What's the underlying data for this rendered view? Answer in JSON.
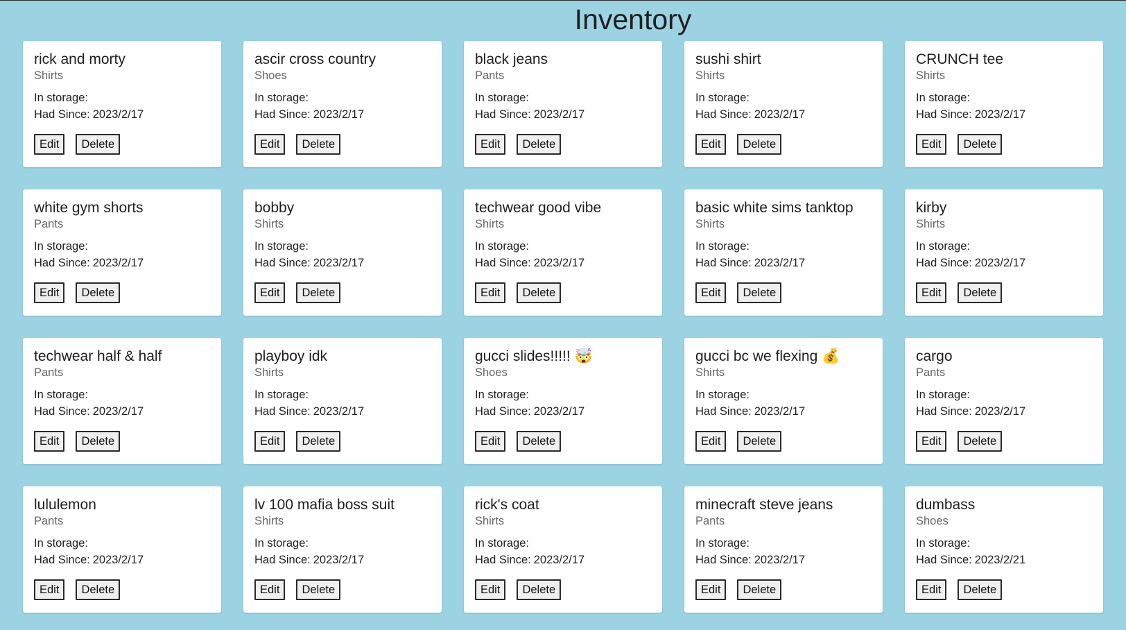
{
  "page": {
    "title": "Inventory"
  },
  "labels": {
    "storage_label": "In storage:",
    "since_label": "Had Since:",
    "edit_label": "Edit",
    "delete_label": "Delete"
  },
  "items": [
    {
      "name": "rick and morty",
      "category": "Shirts",
      "storage": "",
      "since": "2023/2/17"
    },
    {
      "name": "ascir cross country",
      "category": "Shoes",
      "storage": "",
      "since": "2023/2/17"
    },
    {
      "name": "black jeans",
      "category": "Pants",
      "storage": "",
      "since": "2023/2/17"
    },
    {
      "name": "sushi shirt",
      "category": "Shirts",
      "storage": "",
      "since": "2023/2/17"
    },
    {
      "name": "CRUNCH tee",
      "category": "Shirts",
      "storage": "",
      "since": "2023/2/17"
    },
    {
      "name": "white gym shorts",
      "category": "Pants",
      "storage": "",
      "since": "2023/2/17"
    },
    {
      "name": "bobby",
      "category": "Shirts",
      "storage": "",
      "since": "2023/2/17"
    },
    {
      "name": "techwear good vibe",
      "category": "Shirts",
      "storage": "",
      "since": "2023/2/17"
    },
    {
      "name": "basic white sims tanktop",
      "category": "Shirts",
      "storage": "",
      "since": "2023/2/17"
    },
    {
      "name": "kirby",
      "category": "Shirts",
      "storage": "",
      "since": "2023/2/17"
    },
    {
      "name": "techwear half & half",
      "category": "Pants",
      "storage": "",
      "since": "2023/2/17"
    },
    {
      "name": "playboy idk",
      "category": "Shirts",
      "storage": "",
      "since": "2023/2/17"
    },
    {
      "name": "gucci slides!!!!! 🤯",
      "category": "Shoes",
      "storage": "",
      "since": "2023/2/17"
    },
    {
      "name": "gucci bc we flexing 💰",
      "category": "Shirts",
      "storage": "",
      "since": "2023/2/17"
    },
    {
      "name": "cargo",
      "category": "Pants",
      "storage": "",
      "since": "2023/2/17"
    },
    {
      "name": "lululemon",
      "category": "Pants",
      "storage": "",
      "since": "2023/2/17"
    },
    {
      "name": "lv 100 mafia boss suit",
      "category": "Shirts",
      "storage": "",
      "since": "2023/2/17"
    },
    {
      "name": "rick's coat",
      "category": "Shirts",
      "storage": "",
      "since": "2023/2/17"
    },
    {
      "name": "minecraft steve jeans",
      "category": "Pants",
      "storage": "",
      "since": "2023/2/17"
    },
    {
      "name": "dumbass",
      "category": "Shoes",
      "storage": "",
      "since": "2023/2/21"
    }
  ]
}
